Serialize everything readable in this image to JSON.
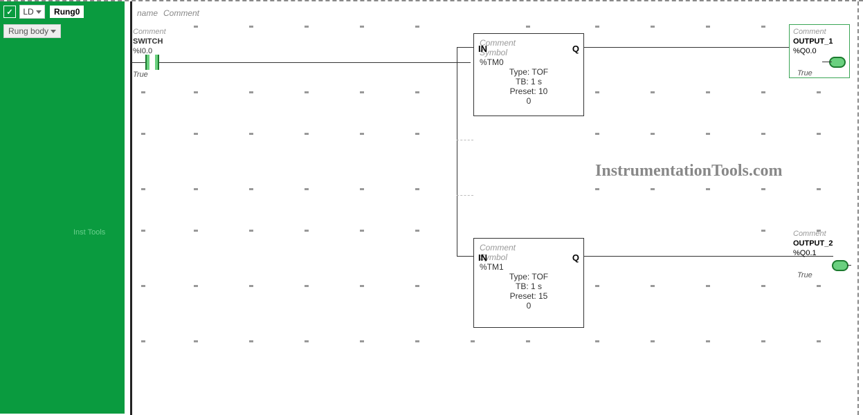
{
  "sidebar": {
    "ld_label": "LD",
    "rung_title": "Rung0",
    "rung_body_label": "Rung body",
    "footer": "Inst Tools"
  },
  "header": {
    "name": "name",
    "comment": "Comment"
  },
  "contact": {
    "comment": "Comment",
    "name": "SWITCH",
    "address": "%I0.0",
    "state": "True"
  },
  "timer1": {
    "comment": "Comment",
    "symbol": "Symbol",
    "address": "%TM0",
    "type": "Type: TOF",
    "tb": "TB:  1 s",
    "preset": "Preset: 10",
    "value": "0",
    "in": "IN",
    "q": "Q"
  },
  "timer2": {
    "comment": "Comment",
    "symbol": "Symbol",
    "address": "%TM1",
    "type": "Type: TOF",
    "tb": "TB:  1 s",
    "preset": "Preset: 15",
    "value": "0",
    "in": "IN",
    "q": "Q"
  },
  "output1": {
    "comment": "Comment",
    "name": "OUTPUT_1",
    "address": "%Q0.0",
    "state": "True"
  },
  "output2": {
    "comment": "Comment",
    "name": "OUTPUT_2",
    "address": "%Q0.1",
    "state": "True"
  },
  "watermark": "InstrumentationTools.com"
}
